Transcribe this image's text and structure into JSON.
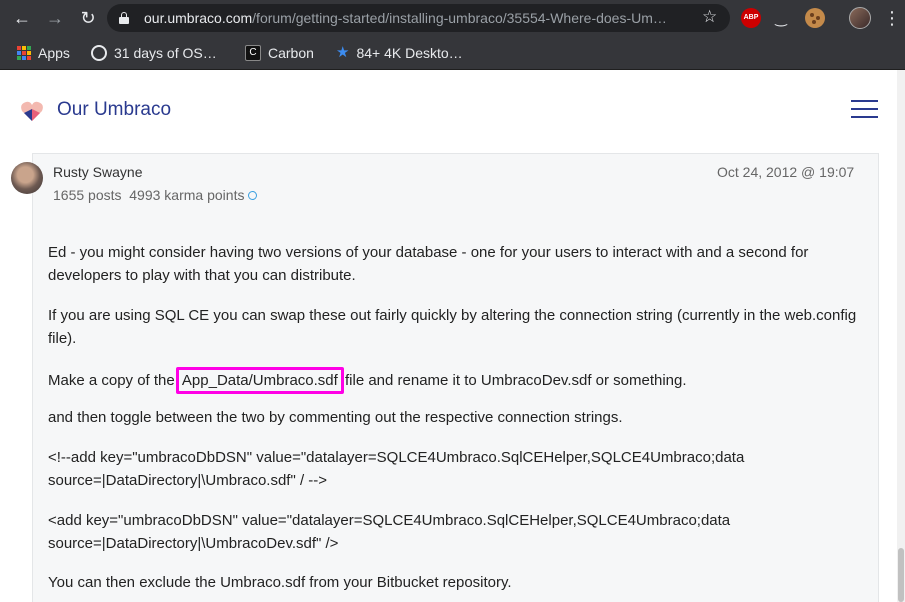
{
  "browser": {
    "url_host": "our.umbraco.com",
    "url_path": "/forum/getting-started/installing-umbraco/35554-Where-does-Um…",
    "extensions": [
      "adblock-plus-icon",
      "mustache-icon",
      "cookie-icon"
    ],
    "abp_label": "ABP"
  },
  "bookmarks": [
    {
      "label": "Apps",
      "icon": "apps-icon"
    },
    {
      "label": "31 days of OS…",
      "icon": "os-icon"
    },
    {
      "label": "Carbon",
      "icon": "carbon-icon"
    },
    {
      "label": "84+ 4K Deskto…",
      "icon": "star-icon"
    }
  ],
  "site": {
    "brand": "Our Umbraco",
    "brand_color": "#2a3a8f"
  },
  "post": {
    "author": "Rusty Swayne",
    "stats": "1655 posts  4993 karma points",
    "date": "Oct 24, 2012 @ 19:07",
    "paragraphs": {
      "p1": "Ed - you might consider having two versions of your database - one for your users to interact with and a second for developers to play with that you can distribute.",
      "p2": "If you are using SQL CE you can swap these out fairly quickly by altering the connection string (currently in the web.config file).",
      "p3_before": "Make a copy of the ",
      "p3_highlight": "App_Data/Umbraco.sdf",
      "p3_after": " file and rename it to UmbracoDev.sdf or something.",
      "p4": "and then toggle between the two by commenting out the respective connection strings.",
      "p5": "<!--add key=\"umbracoDbDSN\" value=\"datalayer=SQLCE4Umbraco.SqlCEHelper,SQLCE4Umbraco;data source=|DataDirectory|\\Umbraco.sdf\" / -->",
      "p6": "<add key=\"umbracoDbDSN\" value=\"datalayer=SQLCE4Umbraco.SqlCEHelper,SQLCE4Umbraco;data source=|DataDirectory|\\UmbracoDev.sdf\" />",
      "p7": "You can then exclude the Umbraco.sdf from your Bitbucket repository."
    },
    "highlight_color": "#ff00e6"
  }
}
